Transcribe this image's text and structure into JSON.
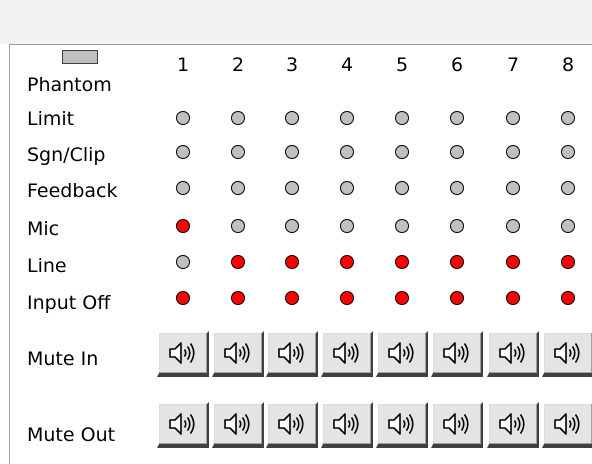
{
  "labels": {
    "phantom": "Phantom",
    "limit": "Limit",
    "sgn_clip": "Sgn/Clip",
    "feedback": "Feedback",
    "mic": "Mic",
    "line": "Line",
    "input_off": "Input Off",
    "mute_in": "Mute In",
    "mute_out": "Mute Out"
  },
  "channels": [
    "1",
    "2",
    "3",
    "4",
    "5",
    "6",
    "7",
    "8"
  ],
  "indicators": {
    "limit": [
      false,
      false,
      false,
      false,
      false,
      false,
      false,
      false
    ],
    "sgn_clip": [
      false,
      false,
      false,
      false,
      false,
      false,
      false,
      false
    ],
    "feedback": [
      false,
      false,
      false,
      false,
      false,
      false,
      false,
      false
    ],
    "mic": [
      true,
      false,
      false,
      false,
      false,
      false,
      false,
      false
    ],
    "line": [
      false,
      true,
      true,
      true,
      true,
      true,
      true,
      true
    ],
    "input_off": [
      true,
      true,
      true,
      true,
      true,
      true,
      true,
      true
    ]
  },
  "colors": {
    "led_on": "#ff0000",
    "led_off": "#c0c0c0",
    "button_face": "#e4e4e4"
  },
  "icons": {
    "mute_button": "speaker-icon",
    "phantom": "phantom-switch-icon"
  }
}
